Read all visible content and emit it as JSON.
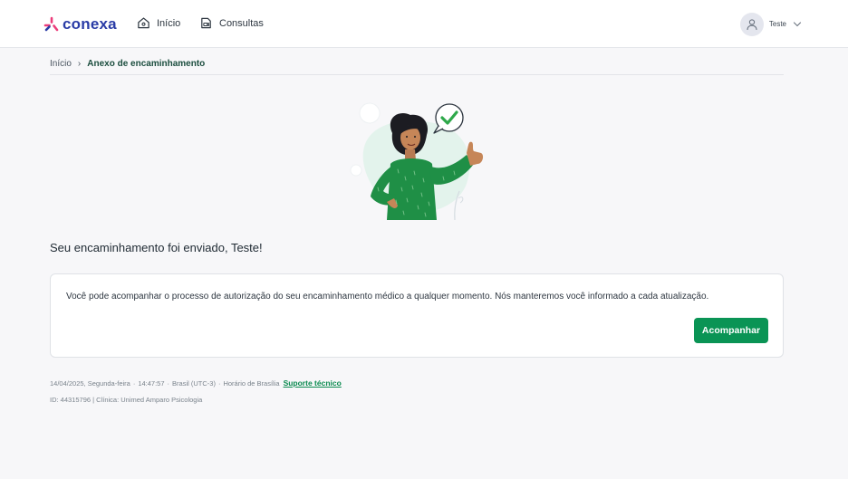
{
  "header": {
    "logo_text": "conexa",
    "nav": [
      {
        "label": "Início",
        "icon": "home-icon"
      },
      {
        "label": "Consultas",
        "icon": "consultations-icon"
      }
    ],
    "user": {
      "name": "Teste"
    }
  },
  "breadcrumb": {
    "home": "Início",
    "separator": "›",
    "current": "Anexo de encaminhamento"
  },
  "main": {
    "heading": "Seu encaminhamento foi enviado, Teste!",
    "card_text": "Você pode acompanhar o processo de autorização do seu encaminhamento médico a qualquer momento. Nós manteremos você informado a cada atualização.",
    "button_label": "Acompanhar"
  },
  "footer": {
    "date": "14/04/2025, Segunda-feira",
    "time": "14:47:57",
    "region": "Brasil (UTC-3)",
    "timezone": "Horário de Brasília",
    "separator": "·",
    "support_link": "Suporte técnico",
    "info": "ID: 44315796 | Clínica: Unimed Amparo Psicologia"
  },
  "colors": {
    "brand_blue": "#2a3ca6",
    "brand_pink": "#ec3c7a",
    "accent_green": "#0a9455"
  }
}
